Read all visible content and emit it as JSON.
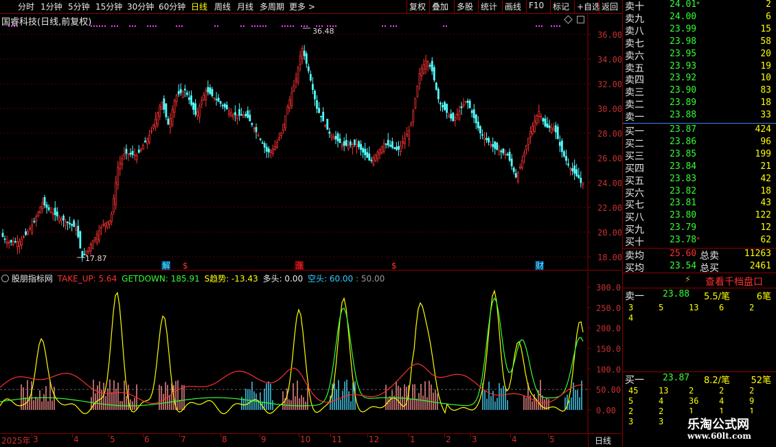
{
  "toolbar": {
    "periods": [
      "分时",
      "1分钟",
      "5分钟",
      "15分钟",
      "30分钟",
      "60分钟",
      "日线",
      "周线",
      "月线",
      "多周期",
      "更多 >"
    ],
    "active_period": "日线",
    "actions": [
      "复权",
      "叠加",
      "多股",
      "统计",
      "画线",
      "F10",
      "标记",
      "+自选",
      "返回"
    ]
  },
  "chart": {
    "title": "国睿科技(日线,前复权)",
    "high_label": "36.48",
    "low_label": "17.87",
    "price_ticks": [
      "36.00",
      "34.00",
      "32.00",
      "30.00",
      "28.00",
      "26.00",
      "24.00",
      "22.00",
      "20.00",
      "18.00"
    ],
    "event_markers": [
      "解",
      "$",
      "涨",
      "$",
      "财"
    ]
  },
  "indicator": {
    "name": "股朋指标网",
    "take_up": "TAKE_UP: 5.64",
    "getdown": "GETDOWN: 185.91",
    "s_trend": "S趋势: -13.43",
    "long": "多头: 0.00",
    "short": "空头: 60.00",
    "level": ": 50.00",
    "ticks": [
      "300.0",
      "250.0",
      "200.0",
      "150.0",
      "100.0",
      "50.00",
      "0.00"
    ],
    "colors": {
      "take_up": "#ff3030",
      "getdown": "#33ff33",
      "s_trend": "#ffff00"
    }
  },
  "time_axis": {
    "labels": [
      "2025年",
      "3",
      "4",
      "5",
      "6",
      "7",
      "8",
      "9",
      "10",
      "11",
      "12",
      "1",
      "2",
      "3",
      "4",
      "5"
    ],
    "period": "日线"
  },
  "orderbook": {
    "asks": [
      {
        "label": "卖十",
        "price": "24.01",
        "vol": "2",
        "mark": "*"
      },
      {
        "label": "卖九",
        "price": "24.00",
        "vol": "6"
      },
      {
        "label": "卖八",
        "price": "23.99",
        "vol": "15"
      },
      {
        "label": "卖七",
        "price": "23.98",
        "vol": "58"
      },
      {
        "label": "卖六",
        "price": "23.95",
        "vol": "20"
      },
      {
        "label": "卖五",
        "price": "23.93",
        "vol": "19"
      },
      {
        "label": "卖四",
        "price": "23.92",
        "vol": "10"
      },
      {
        "label": "卖三",
        "price": "23.90",
        "vol": "83"
      },
      {
        "label": "卖二",
        "price": "23.89",
        "vol": "18"
      },
      {
        "label": "卖一",
        "price": "23.88",
        "vol": "33"
      }
    ],
    "bids": [
      {
        "label": "买一",
        "price": "23.87",
        "vol": "424"
      },
      {
        "label": "买二",
        "price": "23.86",
        "vol": "96"
      },
      {
        "label": "买三",
        "price": "23.85",
        "vol": "199"
      },
      {
        "label": "买四",
        "price": "23.84",
        "vol": "21"
      },
      {
        "label": "买五",
        "price": "23.83",
        "vol": "42"
      },
      {
        "label": "买六",
        "price": "23.82",
        "vol": "18"
      },
      {
        "label": "买七",
        "price": "23.81",
        "vol": "43"
      },
      {
        "label": "买八",
        "price": "23.80",
        "vol": "122"
      },
      {
        "label": "买九",
        "price": "23.79",
        "vol": "12"
      },
      {
        "label": "买十",
        "price": "23.78",
        "vol": "62",
        "mark": "*"
      }
    ],
    "avg_sell": {
      "label": "卖均",
      "price": "25.60",
      "total_label": "总卖",
      "total": "11263"
    },
    "avg_buy": {
      "label": "买均",
      "price": "23.54",
      "total_label": "总买",
      "total": "2461"
    }
  },
  "level10_button": "查看千档盘口",
  "queue": {
    "sell1": {
      "label": "卖一",
      "price": "23.88",
      "per": "5.5/笔",
      "count": "6笔"
    },
    "sell1_orders": [
      "3",
      "5",
      "13",
      "6",
      "2",
      "4"
    ],
    "buy1": {
      "label": "买一",
      "price": "23.87",
      "per": "8.2/笔",
      "count": "52笔"
    },
    "buy1_orders": [
      "45",
      "13",
      "2",
      "2",
      "2",
      "5",
      "4",
      "36",
      "4",
      "9",
      "2",
      "2",
      "1",
      "1",
      "1",
      "3",
      "3",
      "1"
    ]
  },
  "watermark": {
    "name": "乐淘公式网",
    "url": "www.60lt.com"
  }
}
